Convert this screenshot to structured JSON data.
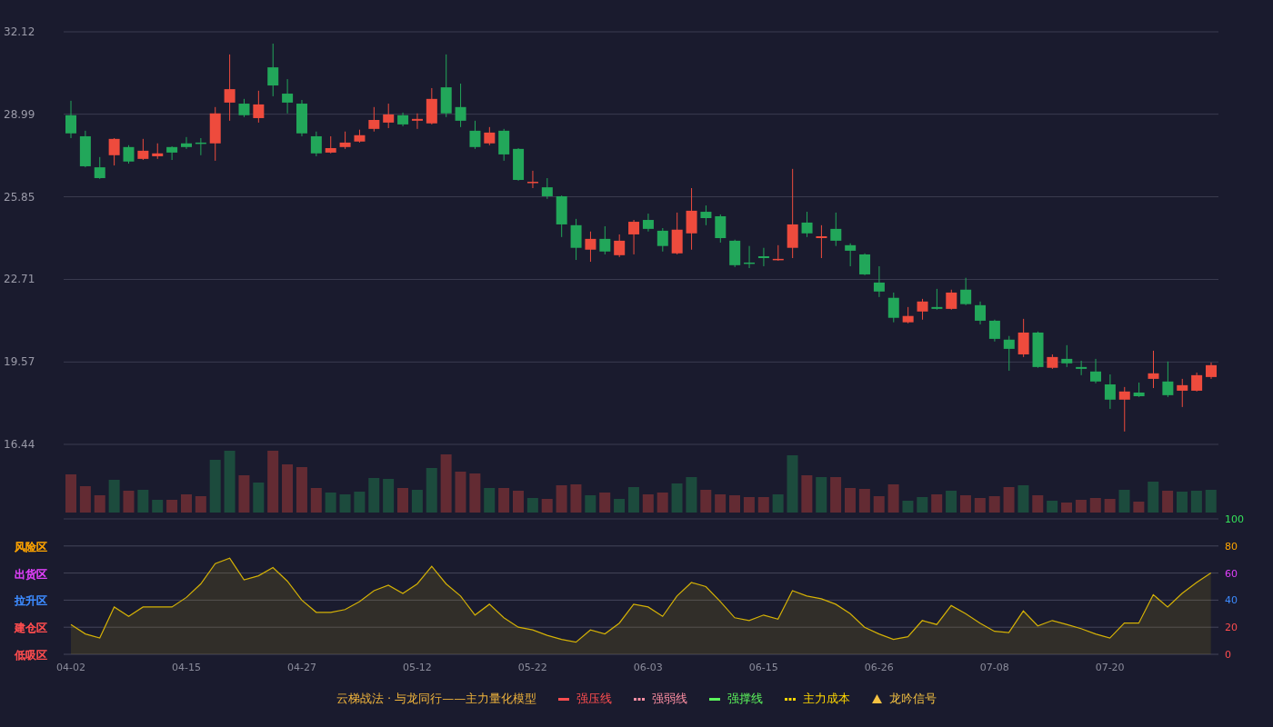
{
  "price_chart": {
    "chart_data": {
      "type": "candlestick",
      "grid": true,
      "ylim": [
        16.44,
        32.12
      ],
      "yticks": [
        {
          "value": 32.12,
          "label": "32.12"
        },
        {
          "value": 28.99,
          "label": "28.99"
        },
        {
          "value": 25.85,
          "label": "25.85"
        },
        {
          "value": 22.71,
          "label": "22.71"
        },
        {
          "value": 19.57,
          "label": "19.57"
        },
        {
          "value": 16.44,
          "label": "16.44"
        }
      ],
      "categories": [
        null,
        null,
        null,
        null,
        null,
        null,
        null,
        null,
        null,
        null,
        null,
        null,
        null,
        null,
        null,
        null,
        null,
        null,
        null,
        null,
        null,
        null,
        null,
        null,
        null,
        null,
        null,
        null,
        null,
        null,
        null,
        null,
        null,
        null,
        null,
        null,
        null,
        null,
        null,
        null,
        null,
        null,
        null,
        null,
        null,
        null,
        null,
        null,
        null,
        null,
        null,
        null,
        null,
        null,
        null,
        null,
        null,
        null,
        null,
        null,
        null,
        null,
        null,
        null,
        null,
        null,
        null,
        null,
        null,
        null,
        null,
        null,
        null,
        null,
        null,
        null,
        null,
        null,
        null,
        null
      ],
      "ohlc": [
        [
          28.95,
          29.5,
          28.08,
          28.26
        ],
        [
          28.15,
          28.36,
          26.97,
          27.01
        ],
        [
          26.97,
          27.36,
          26.53,
          26.56
        ],
        [
          27.43,
          28.08,
          27.04,
          28.05
        ],
        [
          27.74,
          27.81,
          27.11,
          27.19
        ],
        [
          27.29,
          28.05,
          27.25,
          27.6
        ],
        [
          27.39,
          27.88,
          27.29,
          27.5
        ],
        [
          27.74,
          27.77,
          27.25,
          27.53
        ],
        [
          27.88,
          28.12,
          27.67,
          27.74
        ],
        [
          27.91,
          28.08,
          27.43,
          27.88
        ],
        [
          27.88,
          29.26,
          27.22,
          29.02
        ],
        [
          29.43,
          31.26,
          28.74,
          29.94
        ],
        [
          29.39,
          29.57,
          28.88,
          28.95
        ],
        [
          28.84,
          29.88,
          28.67,
          29.36
        ],
        [
          30.77,
          31.67,
          29.67,
          30.08
        ],
        [
          29.77,
          30.32,
          29.02,
          29.43
        ],
        [
          29.39,
          29.53,
          28.15,
          28.26
        ],
        [
          28.15,
          28.33,
          27.39,
          27.5
        ],
        [
          27.53,
          28.15,
          27.5,
          27.7
        ],
        [
          27.74,
          28.33,
          27.67,
          27.91
        ],
        [
          27.95,
          28.4,
          27.91,
          28.19
        ],
        [
          28.43,
          29.26,
          28.33,
          28.77
        ],
        [
          28.67,
          29.39,
          28.46,
          28.98
        ],
        [
          28.95,
          29.05,
          28.53,
          28.6
        ],
        [
          28.74,
          29.02,
          28.43,
          28.81
        ],
        [
          28.64,
          29.98,
          28.6,
          29.57
        ],
        [
          30.01,
          31.26,
          28.88,
          29.02
        ],
        [
          29.26,
          30.15,
          28.5,
          28.74
        ],
        [
          28.36,
          28.74,
          27.67,
          27.74
        ],
        [
          27.88,
          28.5,
          27.81,
          28.29
        ],
        [
          28.36,
          28.43,
          27.22,
          27.46
        ],
        [
          27.67,
          27.7,
          26.46,
          26.49
        ],
        [
          26.39,
          26.84,
          26.18,
          26.42
        ],
        [
          26.21,
          26.56,
          25.77,
          25.87
        ],
        [
          25.87,
          25.9,
          24.32,
          24.8
        ],
        [
          24.77,
          25.01,
          23.45,
          23.91
        ],
        [
          23.84,
          24.53,
          23.38,
          24.25
        ],
        [
          24.25,
          24.73,
          23.66,
          23.77
        ],
        [
          23.63,
          24.42,
          23.56,
          24.18
        ],
        [
          24.42,
          24.97,
          23.66,
          24.9
        ],
        [
          24.97,
          25.21,
          24.53,
          24.63
        ],
        [
          24.56,
          24.66,
          23.77,
          23.98
        ],
        [
          23.7,
          25.25,
          23.66,
          24.6
        ],
        [
          24.46,
          26.18,
          23.84,
          25.32
        ],
        [
          25.28,
          25.52,
          24.77,
          25.04
        ],
        [
          25.11,
          25.18,
          24.11,
          24.28
        ],
        [
          24.18,
          24.22,
          23.18,
          23.25
        ],
        [
          23.35,
          23.98,
          23.14,
          23.32
        ],
        [
          23.59,
          23.91,
          23.21,
          23.52
        ],
        [
          23.45,
          24.01,
          23.42,
          23.49
        ],
        [
          23.91,
          26.91,
          23.52,
          24.8
        ],
        [
          24.87,
          25.28,
          24.32,
          24.46
        ],
        [
          24.28,
          24.77,
          23.52,
          24.35
        ],
        [
          24.63,
          25.25,
          23.98,
          24.18
        ],
        [
          24.01,
          24.08,
          23.21,
          23.8
        ],
        [
          23.66,
          23.7,
          22.87,
          22.9
        ],
        [
          22.59,
          23.21,
          22.04,
          22.25
        ],
        [
          22.01,
          22.21,
          21.08,
          21.25
        ],
        [
          21.08,
          21.66,
          21.04,
          21.32
        ],
        [
          21.49,
          21.97,
          21.18,
          21.87
        ],
        [
          21.66,
          22.35,
          21.56,
          21.59
        ],
        [
          21.59,
          22.32,
          21.56,
          22.21
        ],
        [
          22.32,
          22.77,
          21.73,
          21.77
        ],
        [
          21.73,
          21.87,
          21.0,
          21.14
        ],
        [
          21.14,
          21.18,
          20.35,
          20.45
        ],
        [
          20.42,
          20.56,
          19.24,
          20.07
        ],
        [
          19.86,
          21.21,
          19.76,
          20.69
        ],
        [
          20.69,
          20.73,
          19.35,
          19.38
        ],
        [
          19.35,
          19.86,
          19.31,
          19.76
        ],
        [
          19.69,
          20.21,
          19.38,
          19.52
        ],
        [
          19.38,
          19.62,
          19.07,
          19.31
        ],
        [
          19.21,
          19.69,
          18.76,
          18.83
        ],
        [
          18.72,
          19.1,
          17.79,
          18.14
        ],
        [
          18.14,
          18.62,
          16.93,
          18.45
        ],
        [
          18.41,
          18.79,
          18.24,
          18.27
        ],
        [
          18.93,
          20.0,
          18.58,
          19.14
        ],
        [
          18.83,
          19.59,
          18.24,
          18.31
        ],
        [
          18.48,
          18.93,
          17.86,
          18.69
        ],
        [
          18.48,
          19.17,
          18.45,
          19.07
        ],
        [
          19.0,
          19.55,
          18.93,
          19.45
        ]
      ]
    }
  },
  "indicator_chart": {
    "zones": [
      {
        "label": "风险区",
        "color": "#ffa500"
      },
      {
        "label": "出货区",
        "color": "#e040fb"
      },
      {
        "label": "拉升区",
        "color": "#3d8bff"
      },
      {
        "label": "建仓区",
        "color": "#ff4d4f"
      },
      {
        "label": "低吸区",
        "color": "#ff4d4f"
      }
    ],
    "chart_data": {
      "type": "area",
      "grid": true,
      "ylim": [
        0,
        100
      ],
      "yticks": [
        0,
        20,
        40,
        60,
        80,
        100
      ],
      "categories": [
        "04-02",
        null,
        null,
        null,
        null,
        null,
        null,
        null,
        "04-15",
        null,
        null,
        null,
        null,
        null,
        null,
        null,
        "04-27",
        null,
        null,
        null,
        null,
        null,
        null,
        null,
        "05-12",
        null,
        null,
        null,
        null,
        null,
        null,
        null,
        "05-22",
        null,
        null,
        null,
        null,
        null,
        null,
        null,
        "06-03",
        null,
        null,
        null,
        null,
        null,
        null,
        null,
        "06-15",
        null,
        null,
        null,
        null,
        null,
        null,
        null,
        "06-26",
        null,
        null,
        null,
        null,
        null,
        null,
        null,
        "07-08",
        null,
        null,
        null,
        null,
        null,
        null,
        null,
        "07-20",
        null,
        null,
        null,
        null,
        null,
        null,
        null
      ],
      "series": [
        {
          "color": "#d4b106",
          "values": [
            22,
            15,
            12,
            35,
            28,
            35,
            35,
            35,
            42,
            52,
            67,
            71,
            55,
            58,
            64,
            54,
            40,
            31,
            31,
            33,
            39,
            47,
            51,
            45,
            52,
            65,
            52,
            43,
            29,
            37,
            27,
            20,
            18,
            14,
            11,
            9,
            18,
            15,
            23,
            37,
            35,
            28,
            43,
            53,
            50,
            39,
            27,
            25,
            29,
            26,
            47,
            43,
            41,
            37,
            30,
            20,
            15,
            11,
            13,
            25,
            22,
            36,
            30,
            23,
            17,
            16,
            32,
            21,
            25,
            22,
            19,
            15,
            12,
            23,
            23,
            44,
            35,
            45,
            53,
            60
          ]
        }
      ]
    }
  },
  "legend": {
    "title": "云梯战法 · 与龙同行——主力量化模型",
    "items": [
      {
        "label": "强压线",
        "color": "#ff4d4f",
        "kind": "line"
      },
      {
        "label": "强弱线",
        "color": "#ff8fa3",
        "kind": "dash"
      },
      {
        "label": "强撑线",
        "color": "#5cf55c",
        "kind": "line"
      },
      {
        "label": "主力成本",
        "color": "#ffd700",
        "kind": "dash"
      },
      {
        "label": "龙吟信号",
        "color": "#f5c242",
        "kind": "triangle"
      }
    ]
  }
}
